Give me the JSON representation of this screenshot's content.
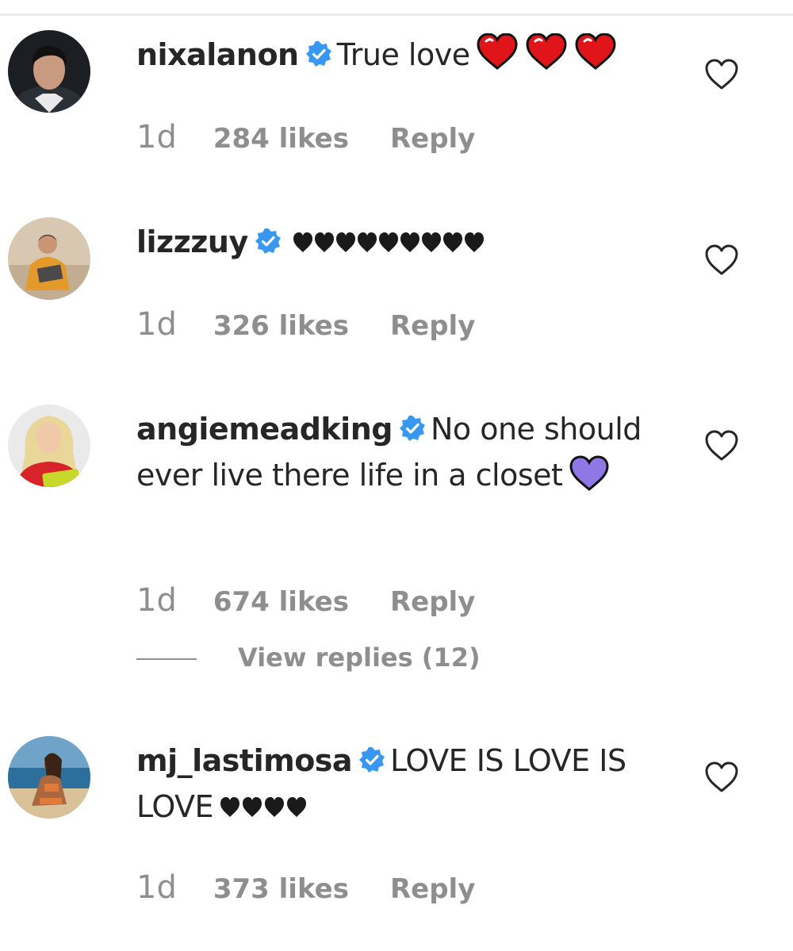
{
  "comments": [
    {
      "username": "nixalanon",
      "text": "True love",
      "emoji": "red-heart",
      "time": "1d",
      "likes": "284 likes",
      "reply": "Reply"
    },
    {
      "username": "lizzzuy",
      "text": "",
      "emoji": "black-heart",
      "time": "1d",
      "likes": "326 likes",
      "reply": "Reply"
    },
    {
      "username": "angiemeadking",
      "text": "No one should ever live there life in a closet",
      "emoji": "purple-heart",
      "time": "1d",
      "likes": "674 likes",
      "reply": "Reply",
      "view_replies": "View replies (12)"
    },
    {
      "username": "mj_lastimosa",
      "text": "LOVE IS LOVE IS LOVE",
      "emoji": "black-heart",
      "time": "1d",
      "likes": "373 likes",
      "reply": "Reply"
    }
  ],
  "colors": {
    "verified": "#3897f0",
    "muted": "#8e8e8e",
    "text": "#262626",
    "red_heart": "#e0151a",
    "purple_heart": "#8f77e6",
    "black_heart": "#1a1a1a"
  }
}
